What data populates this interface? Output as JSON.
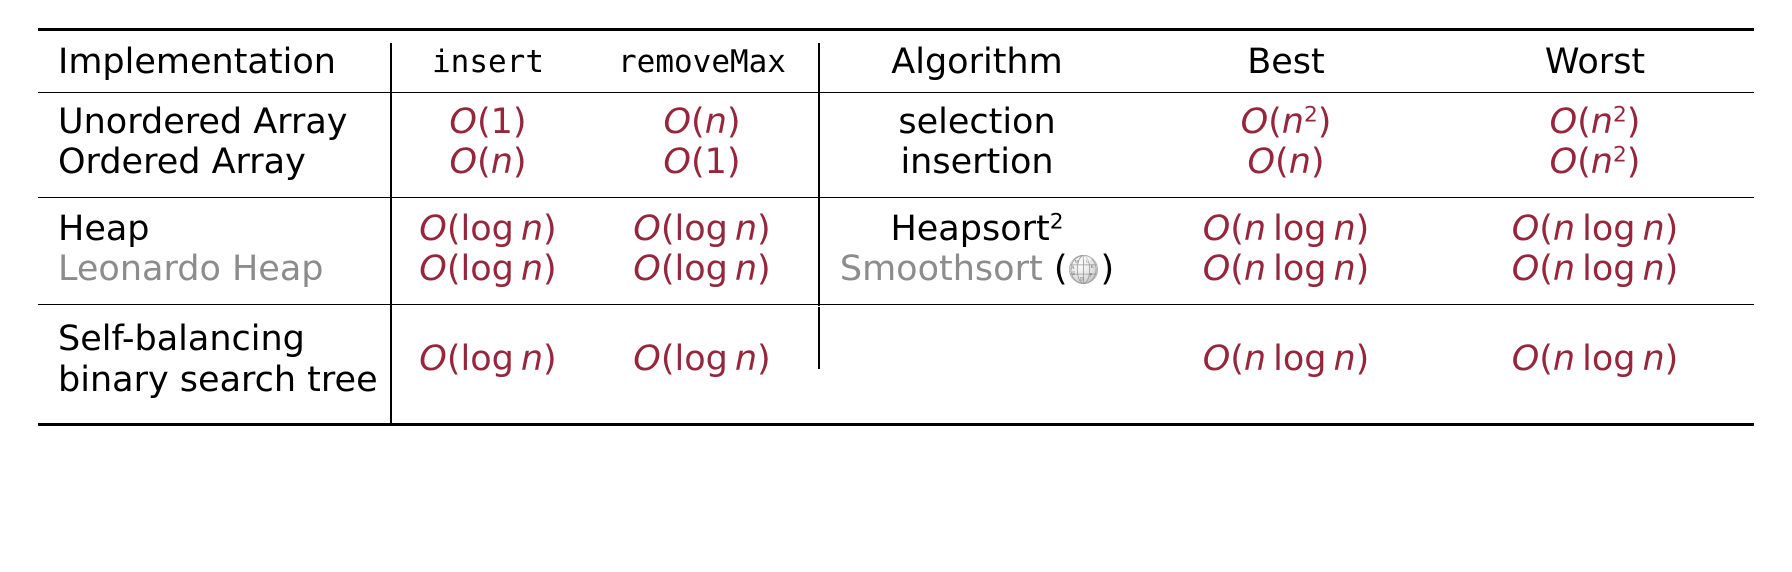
{
  "table": {
    "headers": {
      "implementation": "Implementation",
      "insert": "insert",
      "remove_max": "removeMax",
      "algorithm": "Algorithm",
      "best": "Best",
      "worst": "Worst"
    },
    "groups": [
      {
        "rows": [
          {
            "implementation": "Unordered Array",
            "insert": "O(1)",
            "remove_max": "O(n)",
            "algorithm": "selection",
            "best": "O(n^2)",
            "worst": "O(n^2)",
            "dimmed": false
          },
          {
            "implementation": "Ordered Array",
            "insert": "O(n)",
            "remove_max": "O(1)",
            "algorithm": "insertion",
            "best": "O(n)",
            "worst": "O(n^2)",
            "dimmed": false
          }
        ]
      },
      {
        "rows": [
          {
            "implementation": "Heap",
            "insert": "O(log n)",
            "remove_max": "O(log n)",
            "algorithm": "Heapsort",
            "algorithm_superscript": "2",
            "best": "O(n log n)",
            "worst": "O(n log n)",
            "dimmed": false
          },
          {
            "implementation": "Leonardo Heap",
            "insert": "O(log n)",
            "remove_max": "O(log n)",
            "algorithm": "Smoothsort",
            "algorithm_icon": "wikipedia-globe-icon",
            "best": "O(n log n)",
            "worst": "O(n log n)",
            "dimmed": true
          }
        ]
      },
      {
        "rows": [
          {
            "implementation_line1": "Self-balancing",
            "implementation_line2": "binary search tree",
            "insert": "O(log n)",
            "remove_max": "O(log n)",
            "algorithm": "",
            "best": "O(n log n)",
            "worst": "O(n log n)",
            "dimmed": false
          }
        ]
      }
    ]
  },
  "colors": {
    "complexity_red": "#96263c",
    "dimmed_grey": "#8c8c8c",
    "rule_black": "#000000",
    "background": "#ffffff"
  }
}
